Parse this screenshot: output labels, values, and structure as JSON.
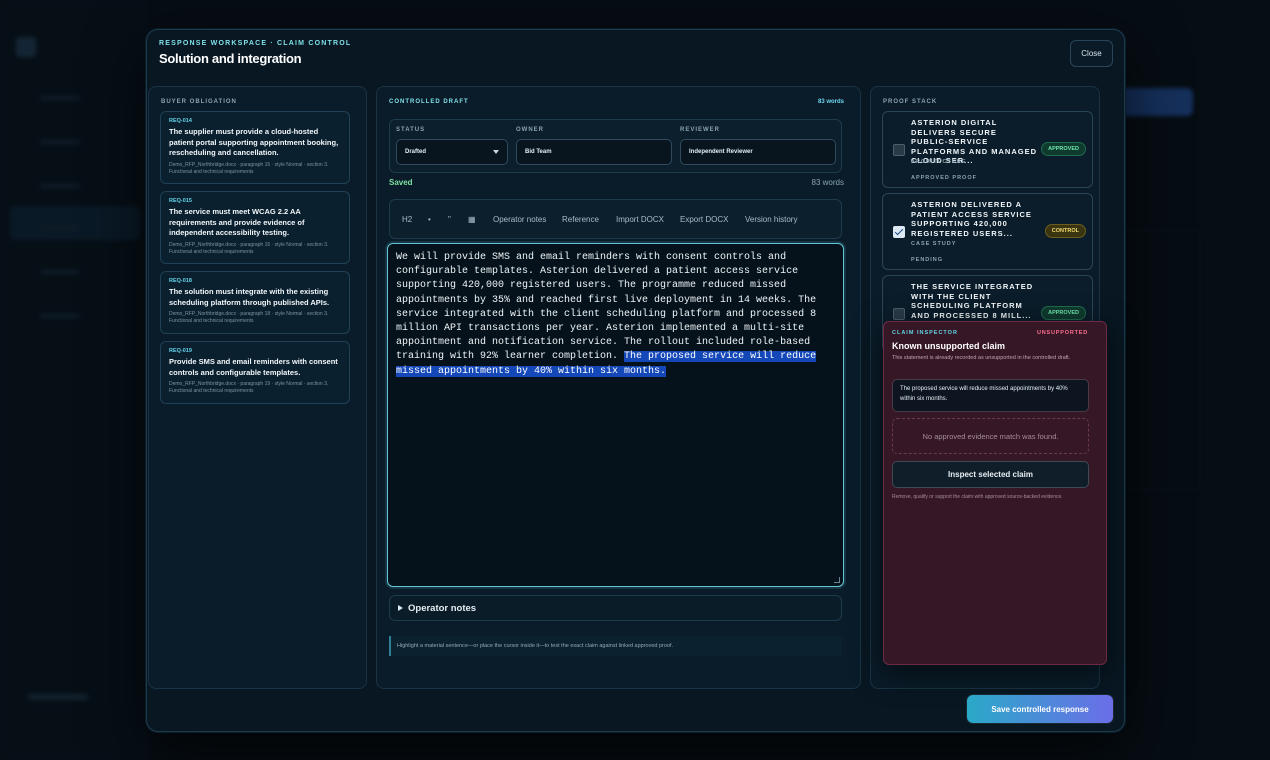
{
  "modal": {
    "eyebrow": "RESPONSE WORKSPACE · CLAIM CONTROL",
    "title": "Solution and integration",
    "close_label": "Close",
    "save_label": "Save controlled response"
  },
  "obligations": {
    "label": "BUYER OBLIGATION",
    "items": [
      {
        "id": "REQ-014",
        "text": "The supplier must provide a cloud-hosted patient portal supporting appointment booking, rescheduling and cancellation.",
        "meta": "Demo_RFP_Northbridge.docx · paragraph 15 · style Normal · section 3. Functional and technical requirements"
      },
      {
        "id": "REQ-015",
        "text": "The service must meet WCAG 2.2 AA requirements and provide evidence of independent accessibility testing.",
        "meta": "Demo_RFP_Northbridge.docx · paragraph 16 · style Normal · section 3. Functional and technical requirements"
      },
      {
        "id": "REQ-018",
        "text": "The solution must integrate with the existing scheduling platform through published APIs.",
        "meta": "Demo_RFP_Northbridge.docx · paragraph 18 · style Normal · section 3. Functional and technical requirements"
      },
      {
        "id": "REQ-019",
        "text": "Provide SMS and email reminders with consent controls and configurable templates.",
        "meta": "Demo_RFP_Northbridge.docx · paragraph 19 · style Normal · section 3. Functional and technical requirements"
      }
    ]
  },
  "draft": {
    "label": "CONTROLLED DRAFT",
    "word_badge": "83 words",
    "status_label": "STATUS",
    "status_value": "Drafted",
    "owner_label": "OWNER",
    "owner_value": "Bid Team",
    "reviewer_label": "REVIEWER",
    "reviewer_value": "Independent Reviewer",
    "saved": "Saved",
    "word_count": "83 words",
    "toolbar": {
      "h2": "H2",
      "bullet": "•",
      "quote": "\"",
      "table": "▦",
      "operator_notes": "Operator notes",
      "reference": "Reference",
      "import": "Import DOCX",
      "export": "Export DOCX",
      "history": "Version history"
    },
    "body_plain": "We will provide SMS and email reminders with consent controls and configurable templates. Asterion delivered a patient access service supporting 420,000 registered users. The programme reduced missed appointments by 35% and reached first live deployment in 14 weeks. The service integrated with the client scheduling platform and processed 8 million API transactions per year. Asterion implemented a multi-site appointment and notification service. The rollout included role-based training with 92% learner completion. ",
    "body_highlight": "The proposed service will reduce missed appointments by 40% within six months.",
    "notes_label": "Operator notes",
    "hint": "Highlight a material sentence—or place the cursor inside it—to test the exact claim against linked approved proof."
  },
  "proof": {
    "label": "PROOF STACK",
    "items": [
      {
        "title": "Asterion Digital delivers secure public-service platforms and managed cloud ser...",
        "kind": "ARCHITECTURE",
        "state": "APPROVED PROOF",
        "badge": "APPROVED",
        "checked": false
      },
      {
        "title": "Asterion delivered a patient access service supporting 420,000 registered users...",
        "kind": "CASE STUDY",
        "state": "PENDING",
        "badge": "CONTROL",
        "checked": true
      },
      {
        "title": "The service integrated with the client scheduling platform and processed 8 mill...",
        "kind": "",
        "state": "",
        "badge": "APPROVED",
        "checked": false
      }
    ]
  },
  "inspector": {
    "eyebrow": "CLAIM INSPECTOR",
    "status": "UNSUPPORTED",
    "title": "Known unsupported claim",
    "desc": "This statement is already recorded as unsupported in the controlled draft.",
    "quote": "The proposed service will reduce missed appointments by 40% within six months.",
    "empty": "No approved evidence match was found.",
    "button": "Inspect selected claim",
    "footer": "Remove, qualify or support the claim with approved source-backed evidence."
  },
  "colors": {
    "accent": "#63d3e8",
    "approved": "#6fe7b0",
    "control": "#f3dd72",
    "unsupported": "#ff6f8e",
    "highlight": "#1447b8"
  }
}
